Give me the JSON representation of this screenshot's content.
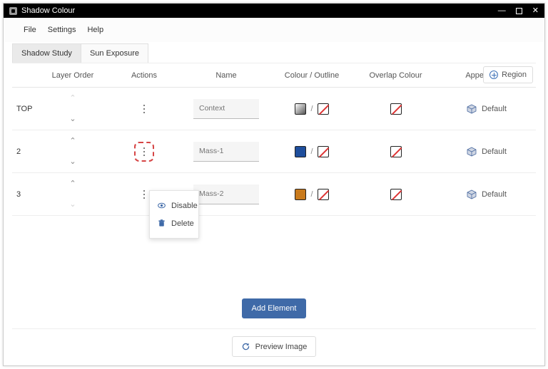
{
  "window": {
    "title": "Shadow Colour"
  },
  "menu": {
    "file": "File",
    "settings": "Settings",
    "help": "Help"
  },
  "tabs": {
    "shadow": "Shadow Study",
    "sun": "Sun Exposure"
  },
  "columns": {
    "layer": "Layer Order",
    "actions": "Actions",
    "name": "Name",
    "colour": "Colour / Outline",
    "overlap": "Overlap Colour",
    "appearance": "Appearance"
  },
  "region_button": "Region",
  "rows": [
    {
      "id": "TOP",
      "name": "Context",
      "fill": "grad-gray",
      "appearance": "Default"
    },
    {
      "id": "2",
      "name": "Mass-1",
      "fill": "blue",
      "appearance": "Default"
    },
    {
      "id": "3",
      "name": "Mass-2",
      "fill": "orange",
      "appearance": "Default"
    }
  ],
  "row_label_TOP": "TOP",
  "row_label_2": "2",
  "row_label_3": "3",
  "slash_sep": "/",
  "popover": {
    "disable": "Disable",
    "delete": "Delete"
  },
  "buttons": {
    "add": "Add Element",
    "preview": "Preview Image"
  }
}
